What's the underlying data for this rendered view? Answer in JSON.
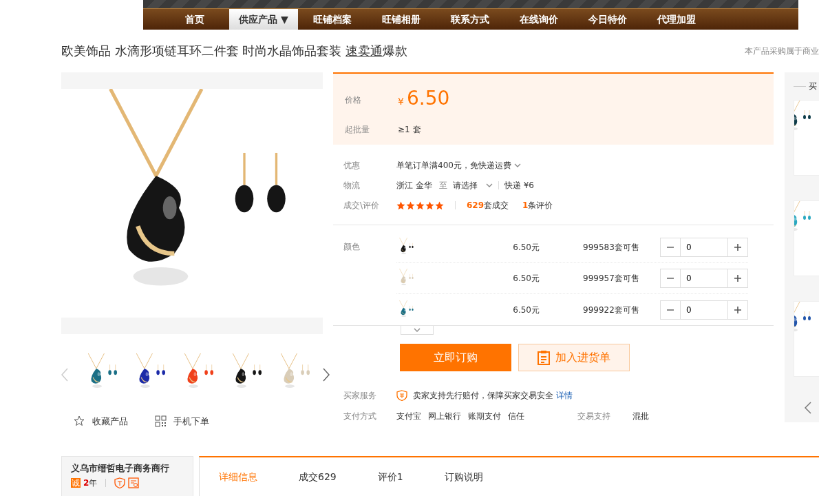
{
  "nav": {
    "items": [
      {
        "label": "首页",
        "selected": false
      },
      {
        "label": "供应产品 ▼",
        "selected": true
      },
      {
        "label": "旺铺档案",
        "selected": false
      },
      {
        "label": "旺铺相册",
        "selected": false
      },
      {
        "label": "联系方式",
        "selected": false
      },
      {
        "label": "在线询价",
        "selected": false
      },
      {
        "label": "今日特价",
        "selected": false
      },
      {
        "label": "代理加盟",
        "selected": false
      }
    ]
  },
  "title": {
    "text": "欧美饰品 水滴形项链耳环二件套 时尚水晶饰品套装 ",
    "link": "速卖通",
    "suffix": "爆款"
  },
  "notice": "本产品采购属于商业",
  "actions": [
    "收藏产品",
    "手机下单"
  ],
  "price": {
    "label": "价格",
    "currency": "¥",
    "amount": "6.50"
  },
  "min_order": {
    "label": "起批量",
    "value": "≥1 套"
  },
  "promo": {
    "label": "优惠",
    "text": "单笔订单满400元，免快递运费"
  },
  "logistics": {
    "label": "物流",
    "origin": "浙江 金华",
    "to": "至",
    "destination": "请选择",
    "method": "快递 ¥6"
  },
  "sales": {
    "label": "成交\\评价",
    "stars": 5,
    "deals_count": "629",
    "deals_suffix": "套成交",
    "reviews_count": "1",
    "reviews_suffix": "条评价"
  },
  "color": {
    "label": "颜色",
    "options": [
      {
        "price": "6.50元",
        "stock_count": "999583",
        "stock_suffix": "套可售",
        "quantity": "0"
      },
      {
        "price": "6.50元",
        "stock_count": "999957",
        "stock_suffix": "套可售",
        "quantity": "0"
      },
      {
        "price": "6.50元",
        "stock_count": "999922",
        "stock_suffix": "套可售",
        "quantity": "0"
      }
    ]
  },
  "buttons": {
    "buy": "立即订购",
    "cart": "加入进货单"
  },
  "service": {
    "label": "买家服务",
    "text": "卖家支持先行赔付，保障买家交易安全",
    "link": "详情"
  },
  "payment": {
    "label": "支付方式",
    "methods": [
      "支付宝",
      "网上银行",
      "账期支付",
      "信任"
    ],
    "trade_label": "交易支持",
    "trade_value": "混批"
  },
  "side": {
    "title": "买"
  },
  "shop": {
    "name": "义乌市缙哲电子商务商行",
    "badge": "诚",
    "years_count": "2",
    "years_suffix": "年"
  },
  "tabs": [
    {
      "label": "详细信息",
      "selected": true
    },
    {
      "label": "成交629",
      "selected": false
    },
    {
      "label": "评价1",
      "selected": false
    },
    {
      "label": "订购说明",
      "selected": false
    }
  ]
}
